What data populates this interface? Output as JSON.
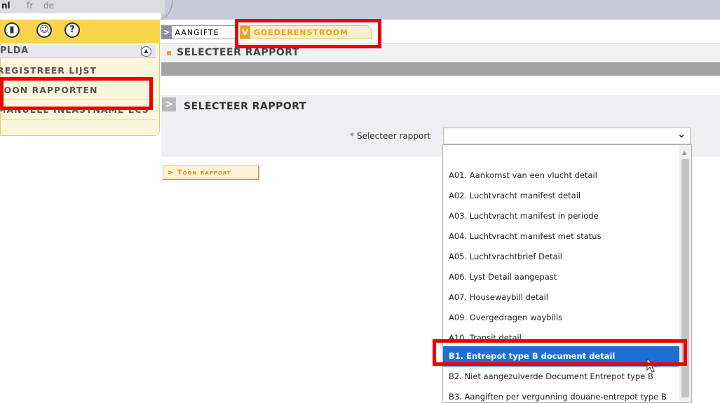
{
  "languages": [
    "nl",
    "fr",
    "de"
  ],
  "left_panel": {
    "title": "PLDA",
    "icons": [
      "door-icon",
      "user-icon",
      "help-icon"
    ],
    "items": [
      "REGISTREER LIJST",
      "TOON RAPPORTEN",
      "MANUELE INLASTNAME ECS"
    ]
  },
  "tabs": [
    {
      "label": "AANGIFTE",
      "arrow": ">"
    },
    {
      "label": "GOEDERENSTROOM",
      "arrow": "V"
    }
  ],
  "main": {
    "header": "SELECTEER RAPPORT",
    "section_title": "SELECTEER RAPPORT",
    "select_label": "Selecteer rapport",
    "required_mark": "*",
    "button_label": "> Toon rapport"
  },
  "dropdown": {
    "options": [
      "",
      "A01. Aankomst van een vlucht detail",
      "A02. Luchtvracht manifest detail",
      "A03. Luchtvracht manifest in periode",
      "A04. Luchtvracht manifest met status",
      "A05. Luchtvrachtbrief Detail",
      "A06. Lyst Detail aangepast",
      "A07. Housewaybill detail",
      "A09. Overgedragen waybills",
      "A10. Transit detail",
      "B1. Entrepot type B document detail",
      "B2. Niet aangezuiverde Document Entrepot type B",
      "B3. Aangiften per vergunning douane-entrepot type B"
    ],
    "selected_index": 10
  },
  "colors": {
    "accent_yellow": "#f7d44a",
    "tab_orange": "#f0a020",
    "highlight_blue": "#1d6fd6",
    "annotation_red": "#ee0000"
  }
}
